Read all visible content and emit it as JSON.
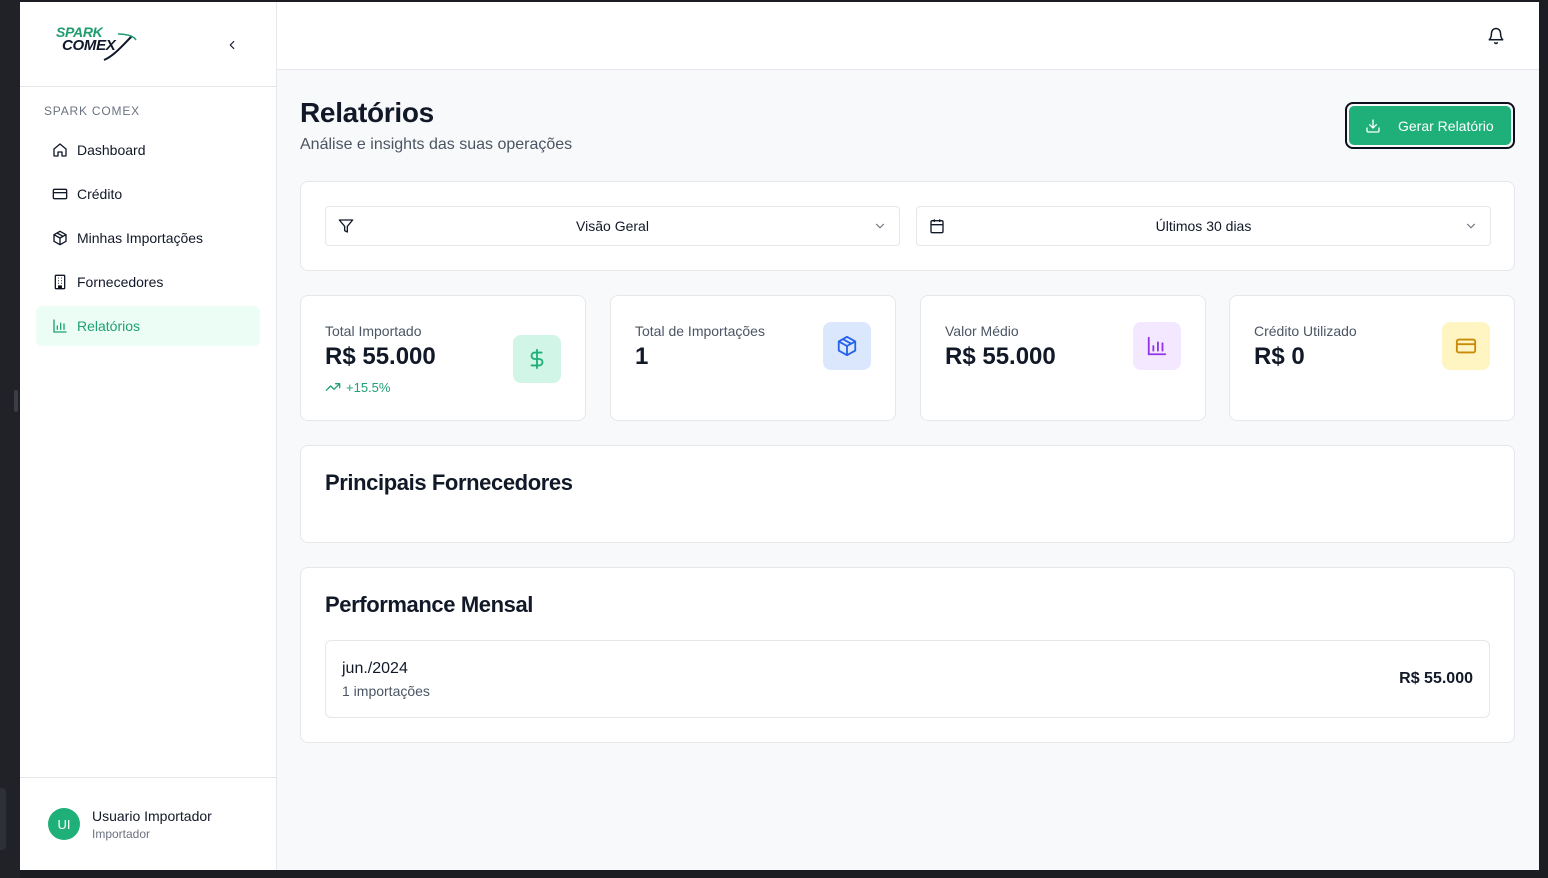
{
  "sidebar": {
    "logo_top": "SPARK",
    "logo_bottom": "COMEX",
    "section_label": "SPARK COMEX",
    "items": [
      {
        "label": "Dashboard",
        "icon": "home-icon"
      },
      {
        "label": "Crédito",
        "icon": "credit-card-icon"
      },
      {
        "label": "Minhas Importações",
        "icon": "package-icon"
      },
      {
        "label": "Fornecedores",
        "icon": "building-icon"
      },
      {
        "label": "Relatórios",
        "icon": "bar-chart-icon",
        "active": true
      }
    ],
    "user": {
      "initials": "UI",
      "name": "Usuario Importador",
      "role": "Importador"
    }
  },
  "header": {
    "title": "Relatórios",
    "subtitle": "Análise e insights das suas operações",
    "generate_label": "Gerar Relatório"
  },
  "filters": {
    "view": "Visão Geral",
    "period": "Últimos 30 dias"
  },
  "stats": [
    {
      "label": "Total Importado",
      "value": "R$ 55.000",
      "trend": "+15.5%",
      "icon": "dollar-icon",
      "color": "#1fb07a"
    },
    {
      "label": "Total de Importações",
      "value": "1",
      "icon": "package-icon",
      "color": "#2563eb"
    },
    {
      "label": "Valor Médio",
      "value": "R$ 55.000",
      "icon": "bar-chart-icon",
      "color": "#9333ea"
    },
    {
      "label": "Crédito Utilizado",
      "value": "R$ 0",
      "icon": "credit-card-icon",
      "color": "#ca8a04"
    }
  ],
  "suppliers": {
    "title": "Principais Fornecedores"
  },
  "performance": {
    "title": "Performance Mensal",
    "rows": [
      {
        "month": "jun./2024",
        "count": "1 importações",
        "value": "R$ 55.000"
      }
    ]
  },
  "colors": {
    "accent": "#1fb07a",
    "accent_bg": "#ecfdf5"
  }
}
